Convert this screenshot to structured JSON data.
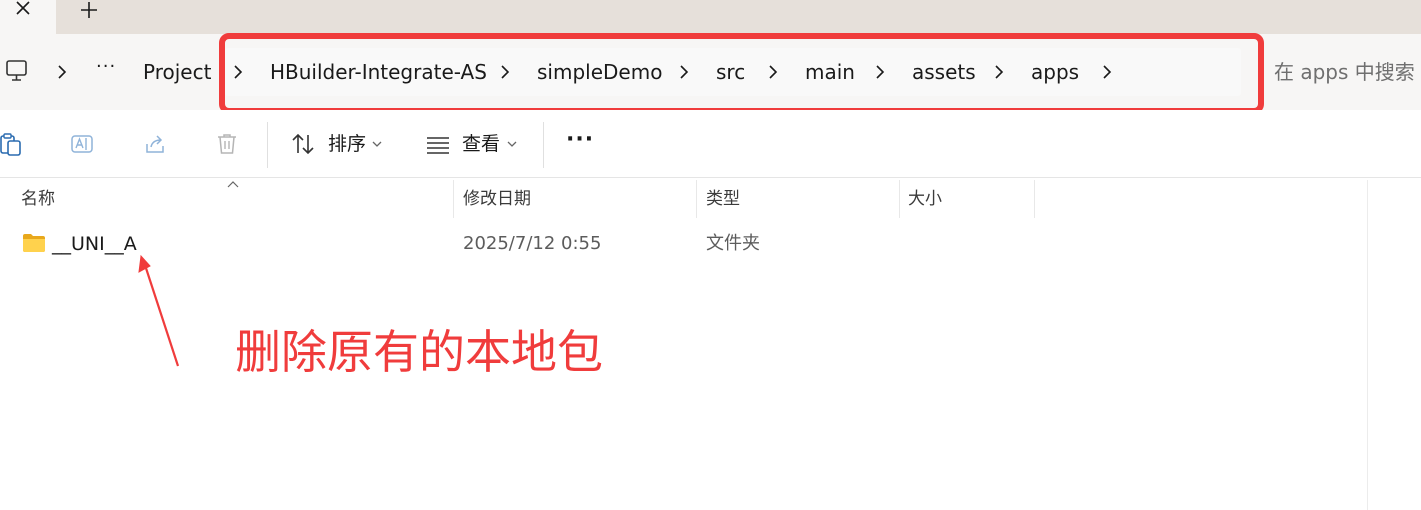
{
  "tabs": {
    "close_glyph": "✕",
    "add_glyph": "+"
  },
  "address_bar": {
    "overflow_label": "···",
    "breadcrumbs": [
      "Project",
      "HBuilder-Integrate-AS",
      "simpleDemo",
      "src",
      "main",
      "assets",
      "apps"
    ],
    "search_placeholder": "在 apps 中搜索"
  },
  "command_bar": {
    "sort_label": "排序",
    "view_label": "查看",
    "more_label": "···"
  },
  "columns": {
    "name": "名称",
    "date_modified": "修改日期",
    "type": "类型",
    "size": "大小"
  },
  "files": [
    {
      "name": "__UNI__A",
      "date_modified": "2025/7/12 0:55",
      "type": "文件夹",
      "size": ""
    }
  ],
  "annotation": {
    "text": "删除原有的本地包",
    "color": "#f03c3c"
  },
  "icons": {
    "computer": "computer-icon",
    "paste": "paste-icon",
    "rename": "rename-icon",
    "share": "share-icon",
    "delete": "delete-icon",
    "sort": "sort-icon",
    "view": "view-icon",
    "folder": "folder-icon"
  }
}
